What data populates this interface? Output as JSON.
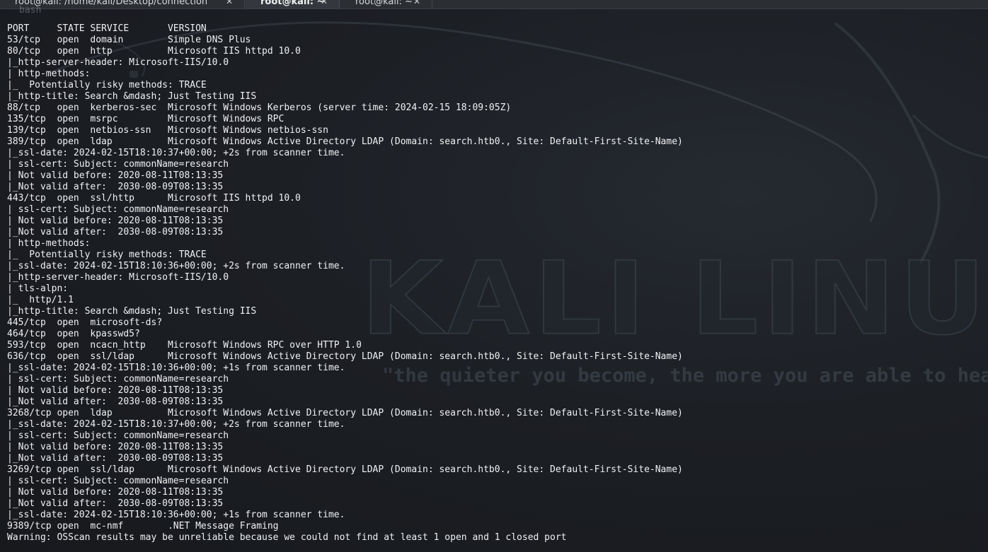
{
  "tabs": [
    {
      "title": "root@kali: /home/kali/Desktop/connection",
      "close": "✕"
    },
    {
      "title": "root@kali: ~",
      "close": "✕"
    },
    {
      "title": "root@kali: ~",
      "close": "✕"
    }
  ],
  "wallpaper": {
    "wordmark": "KALI LINUX",
    "tagline": "\"the quieter you become, the more you are able to hear\""
  },
  "terminal": {
    "previous_line": "bash",
    "lines": [
      "PORT     STATE SERVICE       VERSION",
      "53/tcp   open  domain        Simple DNS Plus",
      "80/tcp   open  http          Microsoft IIS httpd 10.0",
      "|_http-server-header: Microsoft-IIS/10.0",
      "| http-methods: ",
      "|_  Potentially risky methods: TRACE",
      "|_http-title: Search &mdash; Just Testing IIS",
      "88/tcp   open  kerberos-sec  Microsoft Windows Kerberos (server time: 2024-02-15 18:09:05Z)",
      "135/tcp  open  msrpc         Microsoft Windows RPC",
      "139/tcp  open  netbios-ssn   Microsoft Windows netbios-ssn",
      "389/tcp  open  ldap          Microsoft Windows Active Directory LDAP (Domain: search.htb0., Site: Default-First-Site-Name)",
      "|_ssl-date: 2024-02-15T18:10:37+00:00; +2s from scanner time.",
      "| ssl-cert: Subject: commonName=research",
      "| Not valid before: 2020-08-11T08:13:35",
      "|_Not valid after:  2030-08-09T08:13:35",
      "443/tcp  open  ssl/http      Microsoft IIS httpd 10.0",
      "| ssl-cert: Subject: commonName=research",
      "| Not valid before: 2020-08-11T08:13:35",
      "|_Not valid after:  2030-08-09T08:13:35",
      "| http-methods: ",
      "|_  Potentially risky methods: TRACE",
      "|_ssl-date: 2024-02-15T18:10:36+00:00; +2s from scanner time.",
      "|_http-server-header: Microsoft-IIS/10.0",
      "| tls-alpn: ",
      "|_  http/1.1",
      "|_http-title: Search &mdash; Just Testing IIS",
      "445/tcp  open  microsoft-ds?",
      "464/tcp  open  kpasswd5?",
      "593/tcp  open  ncacn_http    Microsoft Windows RPC over HTTP 1.0",
      "636/tcp  open  ssl/ldap      Microsoft Windows Active Directory LDAP (Domain: search.htb0., Site: Default-First-Site-Name)",
      "|_ssl-date: 2024-02-15T18:10:36+00:00; +1s from scanner time.",
      "| ssl-cert: Subject: commonName=research",
      "| Not valid before: 2020-08-11T08:13:35",
      "|_Not valid after:  2030-08-09T08:13:35",
      "3268/tcp open  ldap          Microsoft Windows Active Directory LDAP (Domain: search.htb0., Site: Default-First-Site-Name)",
      "|_ssl-date: 2024-02-15T18:10:37+00:00; +2s from scanner time.",
      "| ssl-cert: Subject: commonName=research",
      "| Not valid before: 2020-08-11T08:13:35",
      "|_Not valid after:  2030-08-09T08:13:35",
      "3269/tcp open  ssl/ldap      Microsoft Windows Active Directory LDAP (Domain: search.htb0., Site: Default-First-Site-Name)",
      "| ssl-cert: Subject: commonName=research",
      "| Not valid before: 2020-08-11T08:13:35",
      "|_Not valid after:  2030-08-09T08:13:35",
      "|_ssl-date: 2024-02-15T18:10:36+00:00; +1s from scanner time.",
      "9389/tcp open  mc-nmf        .NET Message Framing",
      "Warning: OSScan results may be unreliable because we could not find at least 1 open and 1 closed port"
    ]
  },
  "colors": {
    "terminal_text": "#f0f1f3",
    "background": "#1b1d22",
    "tabbar": "#2b2e33",
    "active_tab": "#34383e"
  }
}
